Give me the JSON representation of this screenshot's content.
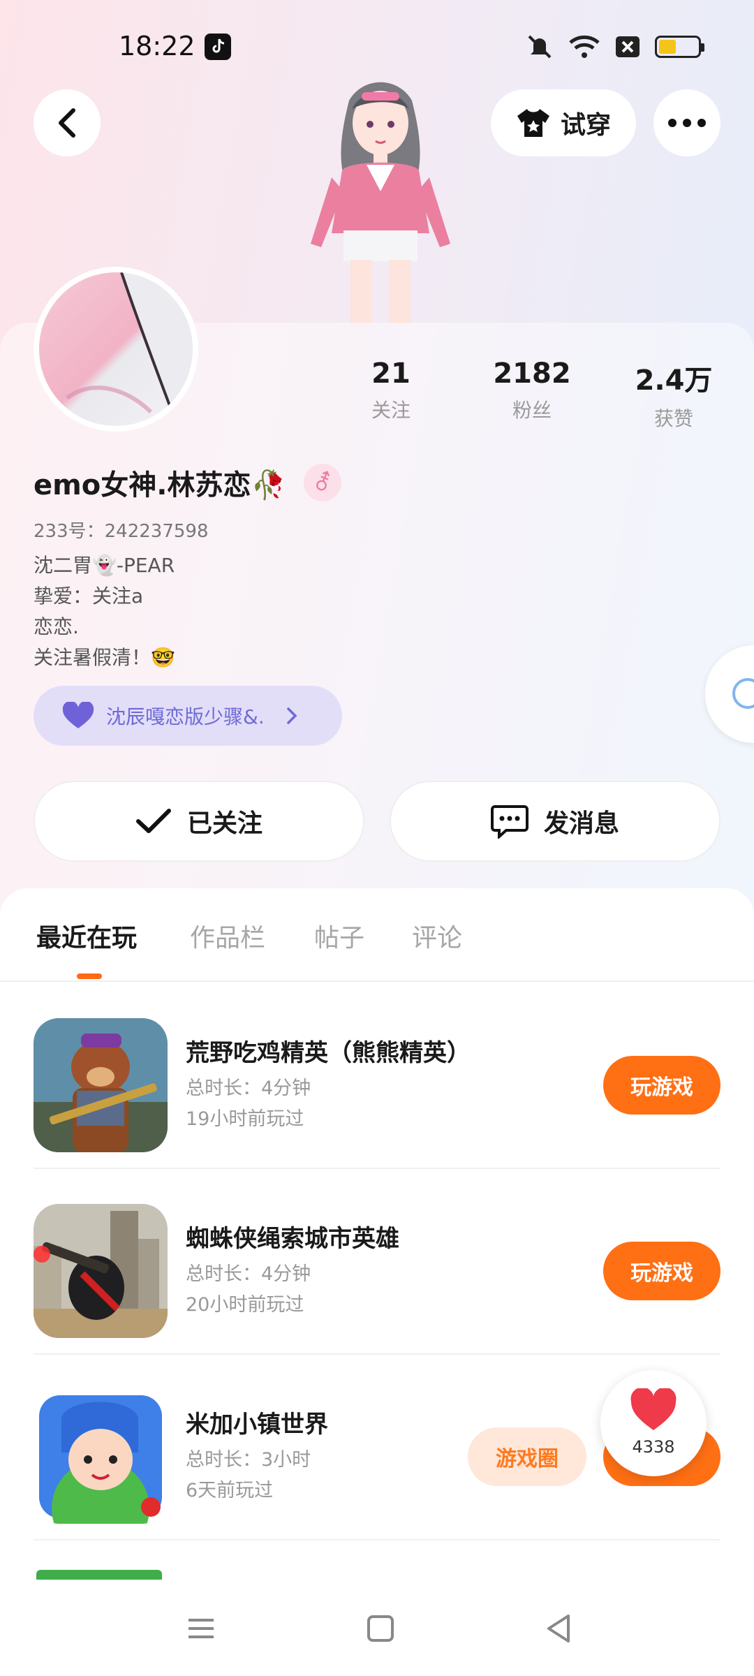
{
  "status_bar": {
    "time": "18:22"
  },
  "top_actions": {
    "try_on_label": "试穿"
  },
  "profile": {
    "nickname": "emo女神.林苏恋🥀",
    "gender_symbol": "⚦",
    "uid_label": "233号：242237598",
    "bio_lines": [
      "沈二胃👻-PEAR",
      "挚爱：关注a",
      "恋恋.",
      "关注暑假清！🤓"
    ],
    "club_label": "沈辰嘎恋版少骤&.",
    "stats": [
      {
        "value": "21",
        "label": "关注"
      },
      {
        "value": "2182",
        "label": "粉丝"
      },
      {
        "value": "2.4万",
        "label": "获赞"
      }
    ],
    "follow_label": "已关注",
    "message_label": "发消息"
  },
  "tabs": [
    {
      "label": "最近在玩",
      "active": true
    },
    {
      "label": "作品栏",
      "active": false
    },
    {
      "label": "帖子",
      "active": false
    },
    {
      "label": "评论",
      "active": false
    }
  ],
  "games": [
    {
      "name": "荒野吃鸡精英（熊熊精英）",
      "duration": "总时长：4分钟",
      "last_played": "19小时前玩过",
      "button": "玩游戏"
    },
    {
      "name": "蜘蛛侠绳索城市英雄",
      "duration": "总时长：4分钟",
      "last_played": "20小时前玩过",
      "button": "玩游戏"
    },
    {
      "name": "米加小镇世界",
      "duration": "总时长：3小时",
      "last_played": "6天前玩过",
      "secondary_button": "游戏圈",
      "button": ""
    }
  ],
  "like_float": {
    "count": "4338"
  },
  "colors": {
    "accent": "#ff6f14",
    "club_text": "#6f6ad6",
    "club_bg": "#e2def8"
  }
}
